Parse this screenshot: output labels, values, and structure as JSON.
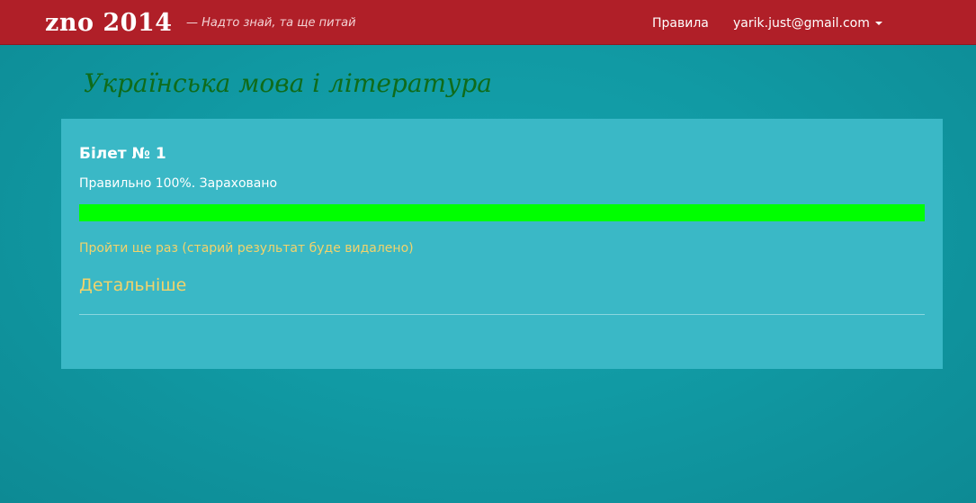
{
  "navbar": {
    "brand": "zno 2014",
    "slogan": "— Надто знай, та ще питай",
    "rules_link": "Правила",
    "user_email": "yarik.just@gmail.com"
  },
  "subject": {
    "title": "Українська мова і література"
  },
  "ticket": {
    "title": "Білет № 1",
    "result": "Правильно 100%. Зараховано",
    "progress_percent": 100,
    "progress_color": "#00ff00",
    "retry_link": "Пройти ще раз (старий результат буде видалено)",
    "details_link": "Детальніше"
  },
  "colors": {
    "navbar": "#b01f28",
    "background": "#119aa4",
    "card": "#3ab8c6",
    "link": "#f2d36b",
    "subject_title": "#0f6b1a"
  }
}
